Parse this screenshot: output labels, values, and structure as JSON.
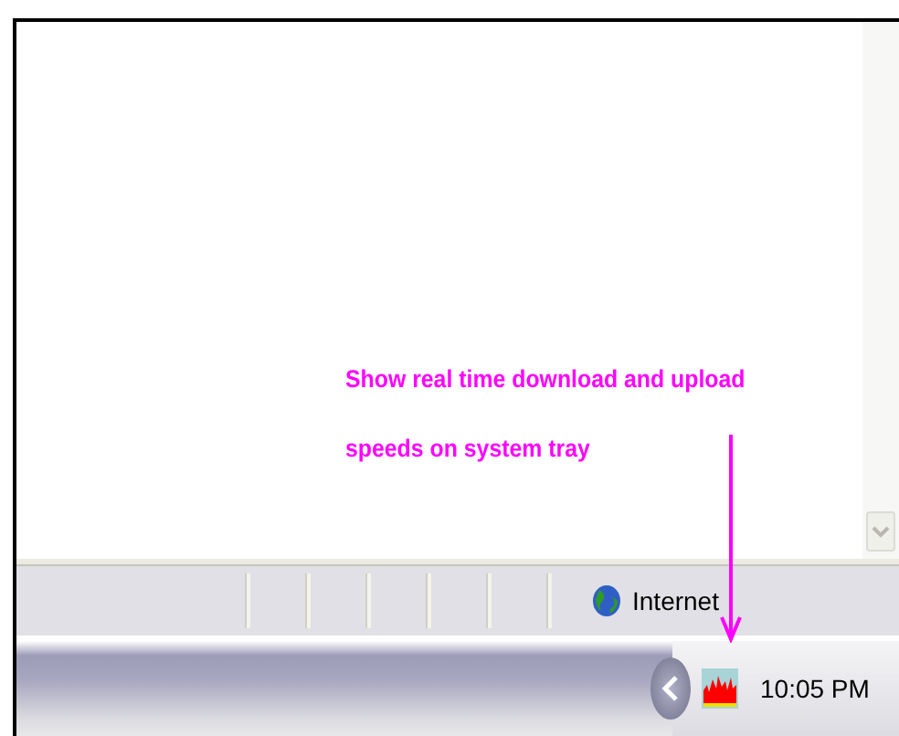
{
  "annotation": {
    "lines": [
      "Show real time download and upload",
      "speeds on system tray"
    ]
  },
  "status_bar": {
    "zone": "Internet"
  },
  "taskbar": {
    "clock": "10:05 PM"
  }
}
